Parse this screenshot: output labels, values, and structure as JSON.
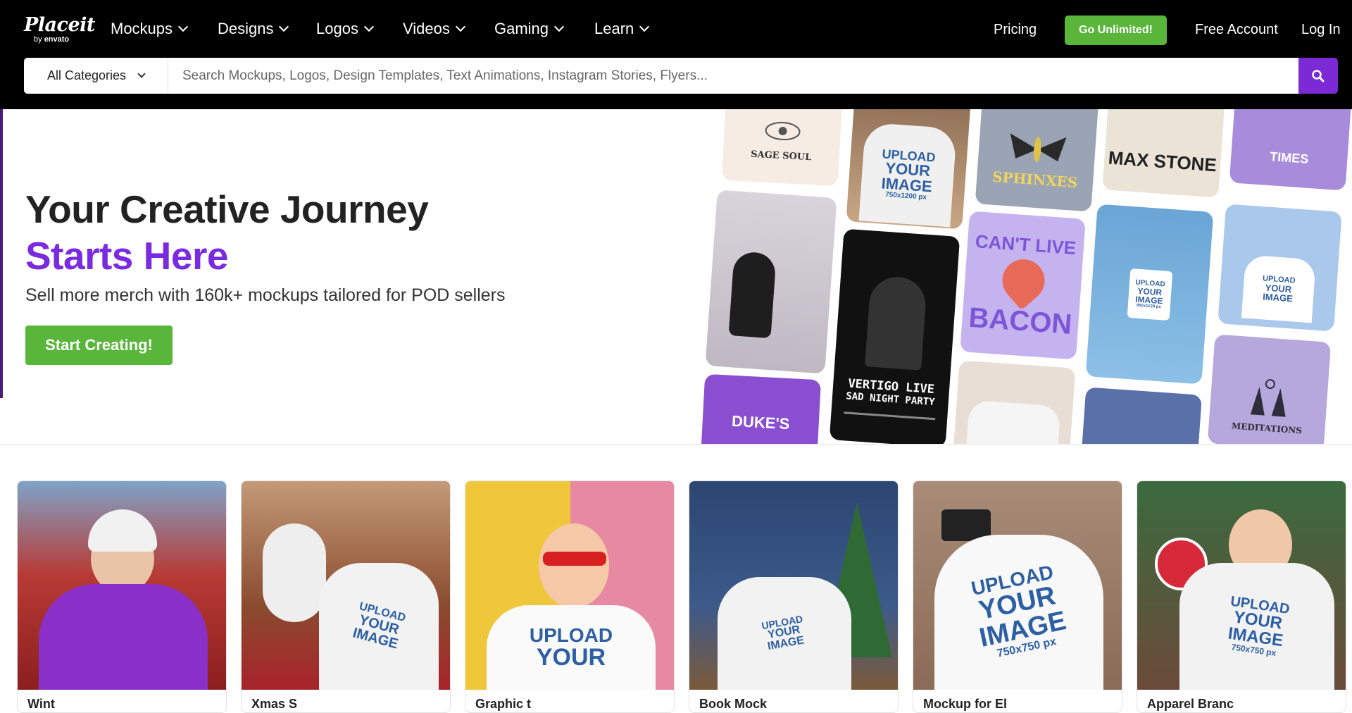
{
  "brand": {
    "logo_word": "Placeit",
    "logo_sub_by": "by",
    "logo_sub_envato": "envato"
  },
  "nav": {
    "items": [
      {
        "label": "Mockups"
      },
      {
        "label": "Designs"
      },
      {
        "label": "Logos"
      },
      {
        "label": "Videos"
      },
      {
        "label": "Gaming"
      },
      {
        "label": "Learn"
      }
    ],
    "pricing": "Pricing",
    "go_unlimited": "Go Unlimited!",
    "free_account": "Free Account",
    "log_in": "Log In"
  },
  "search": {
    "category": "All Categories",
    "placeholder": "Search Mockups, Logos, Design Templates, Text Animations, Instagram Stories, Flyers..."
  },
  "hero": {
    "title_line1": "Your Creative Journey",
    "title_line2": "Starts Here",
    "subtitle": "Sell more merch with 160k+ mockups tailored for POD sellers",
    "cta": "Start Creating!",
    "accent_color": "#7a2be0",
    "cta_color": "#59b63b",
    "tiles": {
      "sage_soul": "SAGE SOUL",
      "sphinxes": "SPHINXES",
      "max_stone": "MAX STONE",
      "times": "TIMES",
      "upload1": "UPLOAD",
      "upload2": "YOUR",
      "upload3": "IMAGE",
      "size_750x1200": "750x1200 px",
      "cant_live": "CAN'T LIVE",
      "bacon": "BACON",
      "vertigo": "VERTIGO LIVE",
      "sad_night": "SAD NIGHT PARTY",
      "dukes": "DUKE'S",
      "meditations": "MEDITATIONS",
      "size_950": "950x1129 px"
    }
  },
  "cards": [
    {
      "title": "Wint"
    },
    {
      "title": "Xmas S"
    },
    {
      "title": "Graphic t"
    },
    {
      "title": "Book Mock"
    },
    {
      "title": "Mockup for El"
    },
    {
      "title": "Apparel Branc"
    }
  ],
  "card_upload": {
    "l1": "UPLOAD",
    "l2": "YOUR",
    "l3": "IMAGE",
    "size": "750x750 px"
  }
}
